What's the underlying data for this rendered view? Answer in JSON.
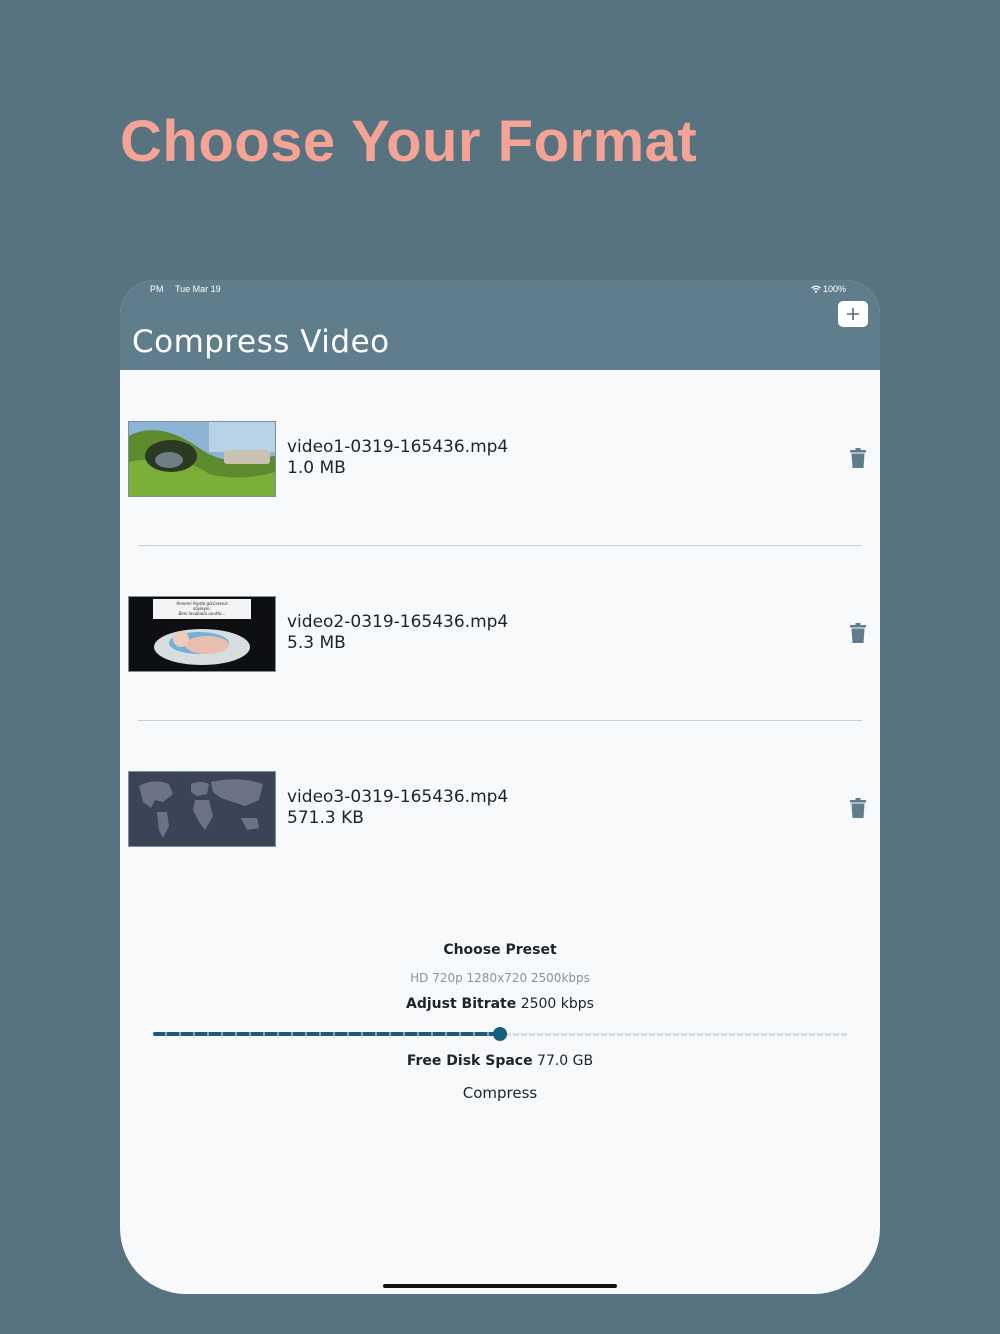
{
  "promo": {
    "title": "Choose Your Format"
  },
  "status_bar": {
    "time": "PM",
    "date": "Tue Mar 19",
    "battery": "100%"
  },
  "nav": {
    "title": "Compress Video",
    "add_icon": "plus-icon"
  },
  "videos": [
    {
      "name": "video1-0319-165436.mp4",
      "size": "1.0 MB",
      "thumb_icon": "landscape-thumbnail"
    },
    {
      "name": "video2-0319-165436.mp4",
      "size": "5.3 MB",
      "thumb_icon": "baby-bath-thumbnail",
      "thumb_caption": "Annemi feyste görürseniz söyleyin, Beni lavabada unuttu..."
    },
    {
      "name": "video3-0319-165436.mp4",
      "size": "571.3 KB",
      "thumb_icon": "world-map-thumbnail"
    }
  ],
  "settings": {
    "preset_label": "Choose Preset",
    "preset_value": "HD 720p 1280x720 2500kbps",
    "bitrate_label": "Adjust Bitrate",
    "bitrate_value": "2500 kbps",
    "bitrate_slider_fraction": 0.5,
    "disk_label": "Free Disk Space",
    "disk_value": "77.0 GB",
    "compress_label": "Compress"
  },
  "colors": {
    "background": "#587380",
    "promo_title": "#f5a394",
    "navbar": "#607d8b",
    "accent": "#13607e",
    "trash": "#607d8b"
  }
}
